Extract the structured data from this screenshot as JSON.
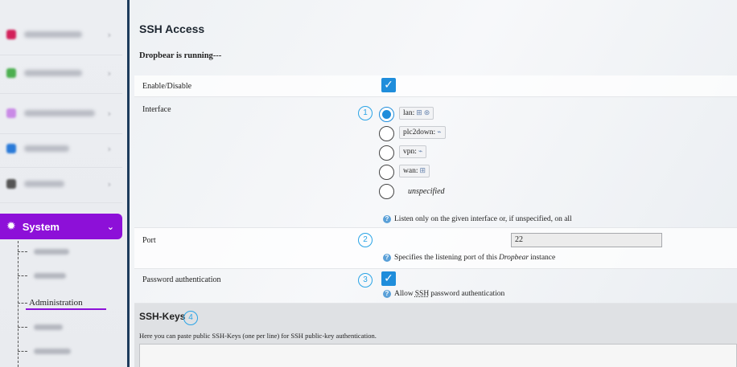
{
  "sidebar": {
    "blurred_items": [
      {
        "color": "#d2205a"
      },
      {
        "color": "#4caf50"
      },
      {
        "color": "#c98ae6"
      },
      {
        "color": "#2a7ad8"
      },
      {
        "color": "#555555"
      }
    ],
    "system": {
      "label": "System",
      "chevron": "⌄",
      "icon": "gear-icon",
      "bg_color": "#8d10d8"
    },
    "sub_items": [
      {
        "label": ""
      },
      {
        "label": ""
      },
      {
        "label": "Administration"
      },
      {
        "label": ""
      },
      {
        "label": ""
      }
    ]
  },
  "main": {
    "title": "SSH Access",
    "status": "Dropbear is running---",
    "enable": {
      "label": "Enable/Disable",
      "checked": true
    },
    "interface": {
      "label": "Interface",
      "annotation": "1",
      "options": [
        {
          "label": "lan:",
          "checked": true
        },
        {
          "label": "plc2down:",
          "checked": false
        },
        {
          "label": "vpn:",
          "checked": false
        },
        {
          "label": "wan:",
          "checked": false
        }
      ],
      "unspecified": "unspecified",
      "help": "Listen only on the given interface or, if unspecified, on all"
    },
    "port": {
      "label": "Port",
      "annotation": "2",
      "value": "22",
      "help_prefix": "Specifies the listening port of this ",
      "help_em": "Dropbear",
      "help_suffix": " instance"
    },
    "password": {
      "label": "Password authentication",
      "annotation": "3",
      "checked": true,
      "help_prefix": "Allow ",
      "help_abbr": "SSH",
      "help_suffix": " password authentication"
    },
    "ssh_keys": {
      "title": "SSH-Keys",
      "annotation": "4",
      "description": "Here you can paste public SSH-Keys (one per line) for SSH public-key authentication."
    }
  },
  "colors": {
    "accent": "#1f8ddb",
    "annotation": "#2aa4e6",
    "divider": "#1d3b5c"
  }
}
